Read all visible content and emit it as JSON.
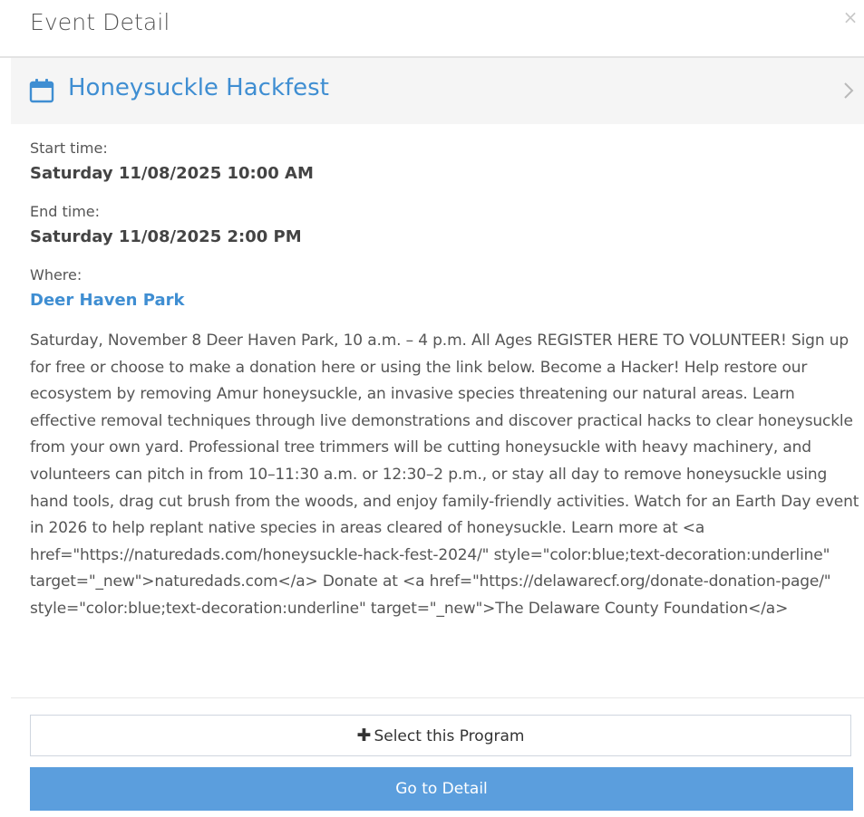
{
  "header": {
    "title": "Event Detail",
    "close_symbol": "×"
  },
  "event": {
    "name": "Honeysuckle Hackfest",
    "icon": "calendar-icon",
    "chevron_icon": "chevron-right-icon"
  },
  "details": {
    "start_label": "Start time:",
    "start_value": "Saturday 11/08/2025 10:00 AM",
    "end_label": "End time:",
    "end_value": "Saturday 11/08/2025 2:00 PM",
    "where_label": "Where:",
    "where_value": "Deer Haven Park"
  },
  "description": "Saturday, November 8 Deer Haven Park, 10 a.m. – 4 p.m. All Ages REGISTER HERE TO VOLUNTEER! Sign up for free or choose to make a donation here or using the link below. Become a Hacker! Help restore our ecosystem by removing Amur honeysuckle, an invasive species threatening our natural areas. Learn effective removal techniques through live demonstrations and discover practical hacks to clear honeysuckle from your own yard. Professional tree trimmers will be cutting honeysuckle with heavy machinery, and volunteers can pitch in from 10–11:30 a.m. or 12:30–2 p.m., or stay all day to remove honeysuckle using hand tools, drag cut brush from the woods, and enjoy family-friendly activities. Watch for an Earth Day event in 2026 to help replant native species in areas cleared of honeysuckle. Learn more at <a href=\"https://naturedads.com/honeysuckle-hack-fest-2024/\" style=\"color:blue;text-decoration:underline\" target=\"_new\">naturedads.com</a> Donate at <a href=\"https://delawarecf.org/donate-donation-page/\" style=\"color:blue;text-decoration:underline\" target=\"_new\">The Delaware County Foundation</a>",
  "footer": {
    "select_icon": "plus-icon",
    "select_symbol": "✚",
    "select_label": "Select this Program",
    "detail_label": "Go to Detail"
  },
  "colors": {
    "accent": "#3f8ed2",
    "button_primary": "#5b9edd",
    "event_bar_bg": "#f5f5f5"
  }
}
